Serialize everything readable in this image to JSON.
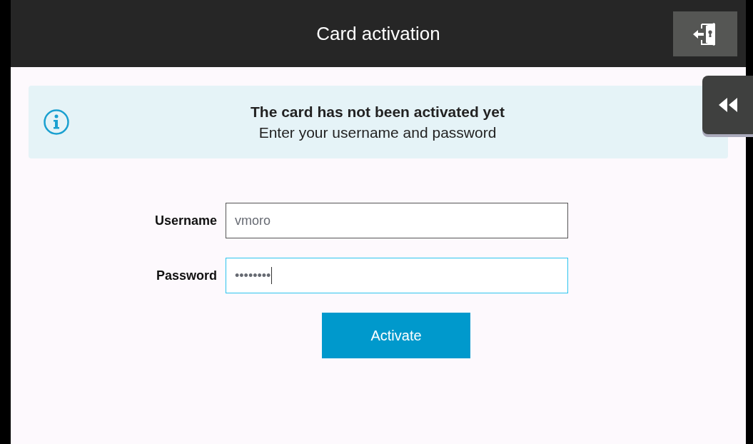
{
  "header": {
    "title": "Card activation"
  },
  "banner": {
    "title": "The card has not been activated yet",
    "message": "Enter your username and password"
  },
  "fields": [
    {
      "label": "Username",
      "value": "vmoro",
      "focused": false
    },
    {
      "label": "Password",
      "value": "••••••••",
      "focused": true
    }
  ],
  "buttons": [
    "Activate"
  ]
}
